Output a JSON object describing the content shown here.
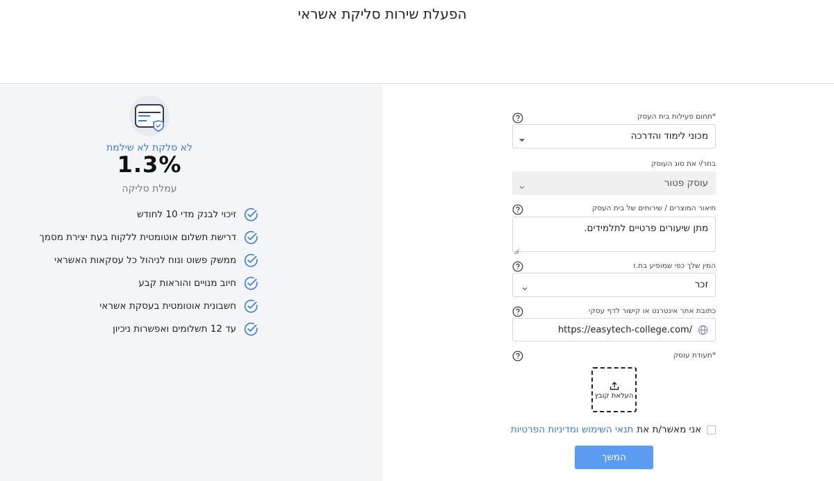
{
  "page": {
    "title": "הפעלת שירות סליקת אשראי"
  },
  "promo": {
    "no_clear_text": "לא סלקת לא שילמת",
    "rate": "1.3%",
    "rate_label": "עמלת סליקה",
    "features": [
      "זיכוי לבנק מדי 10 לחודש",
      "דרישת תשלום אוטומטית ללקוח בעת יצירת מסמך",
      "ממשק פשוט ונוח לניהול כל עסקאות האשראי",
      "חיוב מנויים והוראות קבע",
      "חשבונית אוטומטית בעסקת אשראי",
      "עד 12 תשלומים ואפשרות ניכיון"
    ],
    "accent_color": "#3a7bd5"
  },
  "form": {
    "business_field": {
      "label": "*תחום פעילות בית העסק",
      "value": "מכוני לימוד והדרכה"
    },
    "business_type": {
      "label": "בחר/י את סוג העוסק",
      "value": "עוסק פטור"
    },
    "description": {
      "label": "תיאור המוצרים / שירותים של בית העסק",
      "value": "מתן שיעורים פרטיים לתלמידים."
    },
    "gender": {
      "label": "המין שלך כפי שמופיע בת.ז",
      "value": "זכר"
    },
    "website": {
      "label": "כתובת אתר אינטרנט או קישור לדף עסקי",
      "value": "https://easytech-college.com/"
    },
    "certificate": {
      "label": "*תעודת עוסק",
      "upload_label": "העלאת קובץ"
    },
    "terms": {
      "prefix": "אני מאשר/ת את",
      "link_text": "תנאי השימוש ומדיניות הפרטיות"
    },
    "submit_label": "המשך"
  },
  "icons": {
    "credit_card": "credit-card-shield-icon",
    "check": "check-circle-icon",
    "help": "question-circle-icon",
    "globe": "globe-icon",
    "upload": "upload-icon"
  },
  "colors": {
    "primary_button": "#5b9cf0",
    "link": "#3a7bd5",
    "panel_bg": "#f4f5f7"
  }
}
